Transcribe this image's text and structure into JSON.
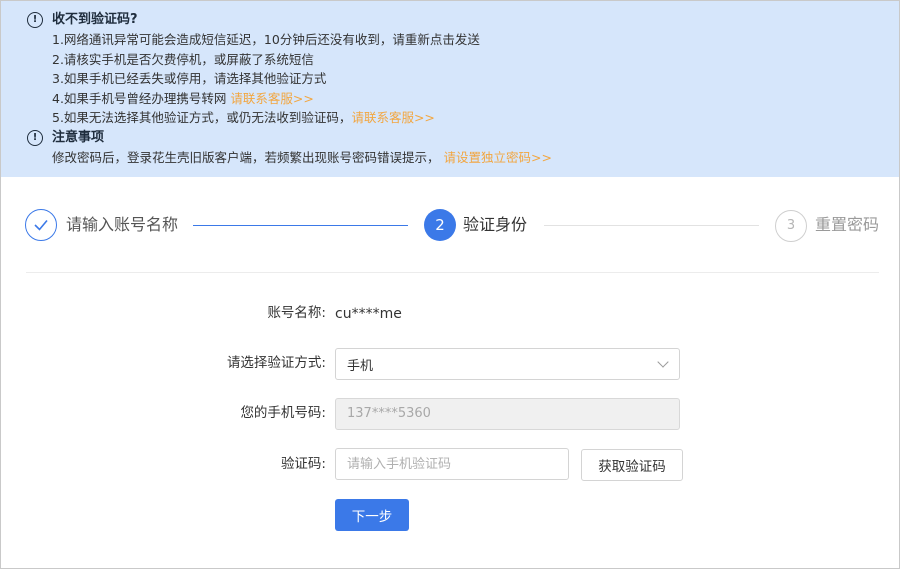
{
  "notice": {
    "sections": [
      {
        "icon": "info-icon",
        "title": "收不到验证码?"
      },
      {
        "icon": "info-icon",
        "title": "注意事项"
      }
    ],
    "lines": [
      {
        "text": "1.网络通讯异常可能会造成短信延迟，10分钟后还没有收到，请重新点击发送",
        "link": ""
      },
      {
        "text": "2.请核实手机是否欠费停机，或屏蔽了系统短信",
        "link": ""
      },
      {
        "text": "3.如果手机已经丢失或停用，请选择其他验证方式",
        "link": ""
      },
      {
        "text": "4.如果手机号曾经办理携号转网",
        "link": "请联系客服>>"
      },
      {
        "text": "5.如果无法选择其他验证方式，或仍无法收到验证码，",
        "link": "请联系客服>>"
      },
      {
        "text": "修改密码后，登录花生壳旧版客户端，若频繁出现账号密码错误提示，",
        "link": "请设置独立密码>>"
      }
    ],
    "icon_glyph": "!"
  },
  "steps": [
    {
      "index": "",
      "label": "请输入账号名称",
      "state": "done",
      "icon": "check-icon"
    },
    {
      "index": "2",
      "label": "验证身份",
      "state": "active"
    },
    {
      "index": "3",
      "label": "重置密码",
      "state": "todo"
    }
  ],
  "form": {
    "account_label": "账号名称:",
    "account_value": "cu****me",
    "method_label": "请选择验证方式:",
    "method_value": "手机",
    "phone_label": "您的手机号码:",
    "phone_value": "137****5360",
    "code_label": "验证码:",
    "code_placeholder": "请输入手机验证码",
    "get_code_label": "获取验证码",
    "next_label": "下一步"
  },
  "colors": {
    "banner_bg": "#d6e6fb",
    "primary": "#3b79e8",
    "link": "#f2a640",
    "inactive": "#cfcfcf"
  }
}
